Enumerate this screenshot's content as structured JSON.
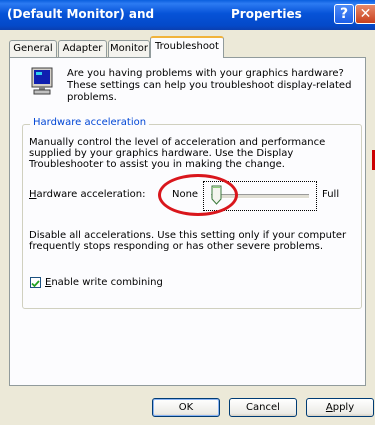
{
  "window": {
    "title_left": "(Default Monitor) and",
    "title_right": "Properties",
    "help_glyph": "?",
    "close_glyph": "✕"
  },
  "tabs": [
    {
      "label": "General",
      "active": false
    },
    {
      "label": "Adapter",
      "active": false
    },
    {
      "label": "Monitor",
      "active": false
    },
    {
      "label": "Troubleshoot",
      "active": true
    }
  ],
  "intro": {
    "icon": "monitor-icon",
    "text": "Are you having problems with your graphics hardware? These settings can help you troubleshoot display-related problems."
  },
  "hardware_acceleration": {
    "group_title": "Hardware acceleration",
    "description": "Manually control the level of acceleration and performance supplied by your graphics hardware. Use the Display Troubleshooter to assist you in making the change.",
    "label_prefix": "",
    "label_underlined": "H",
    "label_rest": "ardware acceleration:",
    "min_label": "None",
    "max_label": "Full",
    "slider_level": 0,
    "disable_text": "Disable all accelerations. Use this setting only if your computer frequently stops responding or has other severe problems."
  },
  "write_combining": {
    "checked": true,
    "label_underlined": "E",
    "label_rest": "nable write combining"
  },
  "buttons": {
    "ok": "OK",
    "cancel": "Cancel",
    "apply_underlined": "A",
    "apply_rest": "pply"
  },
  "colors": {
    "titlebar": "#0653d8",
    "group_title": "#0046d5",
    "annotation_ring": "#d9161c",
    "tab_highlight": "#f1b33b"
  }
}
